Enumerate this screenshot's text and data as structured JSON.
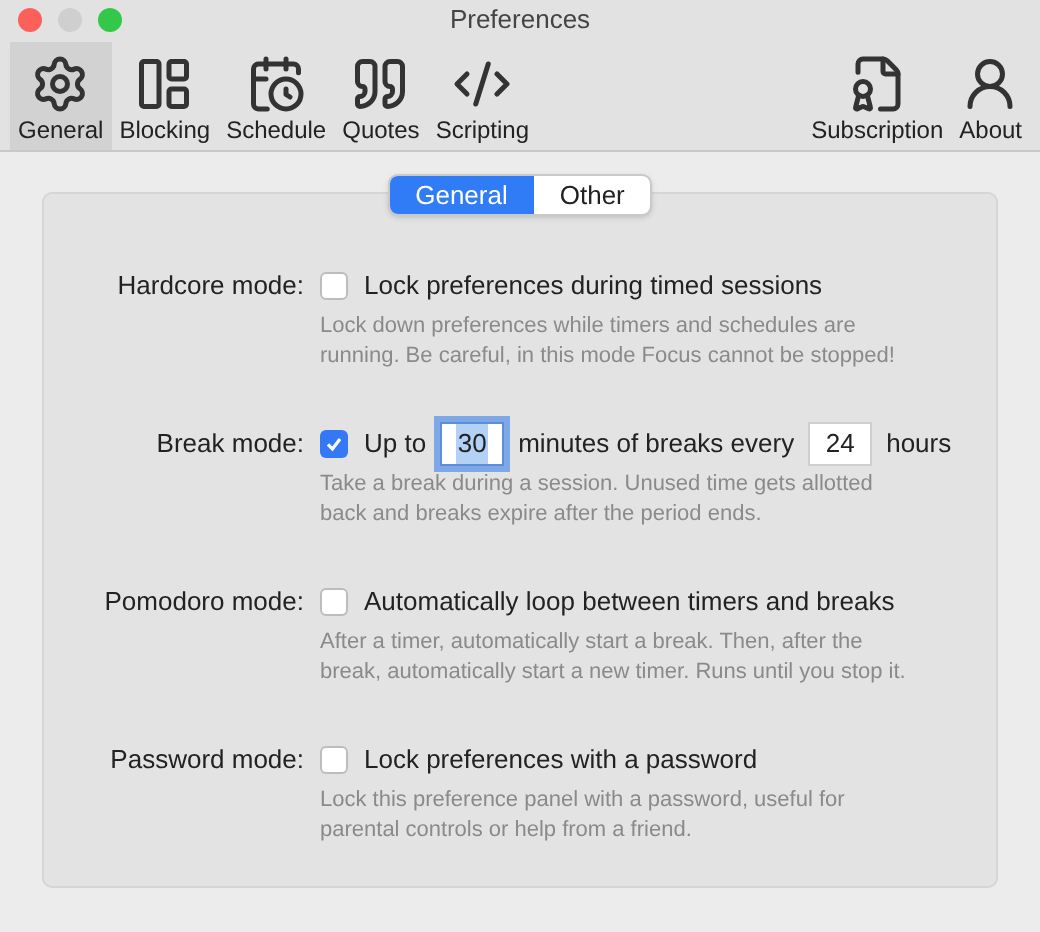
{
  "window": {
    "title": "Preferences"
  },
  "toolbar": [
    {
      "label": "General",
      "selected": true
    },
    {
      "label": "Blocking",
      "selected": false
    },
    {
      "label": "Schedule",
      "selected": false
    },
    {
      "label": "Quotes",
      "selected": false
    },
    {
      "label": "Scripting",
      "selected": false
    },
    {
      "label": "Subscription",
      "selected": false
    },
    {
      "label": "About",
      "selected": false
    }
  ],
  "tabs": [
    {
      "label": "General",
      "selected": true
    },
    {
      "label": "Other",
      "selected": false
    }
  ],
  "settings": [
    {
      "label": "Hardcore mode:",
      "checked": false,
      "parts": [
        {
          "kind": "text",
          "text": "Lock preferences during timed sessions"
        }
      ],
      "description": "Lock down preferences while timers and schedules are running. Be careful, in this mode Focus cannot be stopped!"
    },
    {
      "label": "Break mode:",
      "checked": true,
      "parts": [
        {
          "kind": "text",
          "text": "Up to"
        },
        {
          "kind": "field",
          "value": "30",
          "focused": true
        },
        {
          "kind": "text",
          "text": "minutes of breaks every"
        },
        {
          "kind": "field",
          "value": "24",
          "focused": false
        },
        {
          "kind": "text",
          "text": "hours"
        }
      ],
      "description": "Take a break during a session. Unused time gets allotted back and breaks expire after the period ends."
    },
    {
      "label": "Pomodoro mode:",
      "checked": false,
      "parts": [
        {
          "kind": "text",
          "text": "Automatically loop between timers and breaks"
        }
      ],
      "description": "After a timer, automatically start a break. Then, after the break, automatically start a new timer. Runs until you stop it."
    },
    {
      "label": "Password mode:",
      "checked": false,
      "parts": [
        {
          "kind": "text",
          "text": "Lock preferences with a password"
        }
      ],
      "description": "Lock this preference panel with a password, useful for parental controls or help from a friend."
    }
  ]
}
